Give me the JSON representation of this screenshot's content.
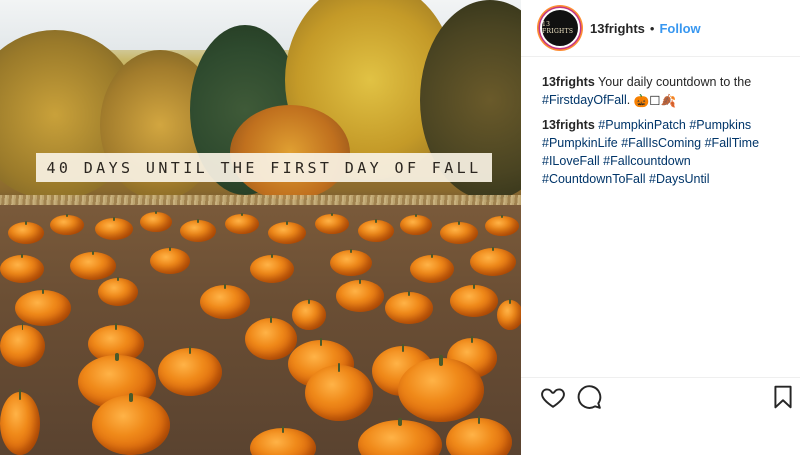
{
  "post": {
    "image_banner_text": "40 DAYS UNTIL THE FIRST DAY OF FALL"
  },
  "header": {
    "avatar_text": "13 FRIGHTS",
    "username": "13frights",
    "separator": "•",
    "follow_label": "Follow"
  },
  "caption": {
    "author": "13frights",
    "text": "Your daily countdown to the",
    "hashtag_1": "#FirstdayOfFall",
    "text_after": ".",
    "emoji": "🎃☐🍂"
  },
  "comment": {
    "author": "13frights",
    "hashtags": [
      "#PumpkinPatch",
      "#Pumpkins",
      "#PumpkinLife",
      "#FallIsComing",
      "#FallTime",
      "#ILoveFall",
      "#Fallcountdown",
      "#CountdownToFall",
      "#DaysUntil"
    ]
  },
  "actions": {
    "like_icon": "heart-icon",
    "comment_icon": "speech-bubble-icon",
    "save_icon": "bookmark-icon"
  },
  "colors": {
    "link_blue": "#3897f0",
    "hashtag_navy": "#003569",
    "pumpkin_orange": "#e8761a"
  }
}
